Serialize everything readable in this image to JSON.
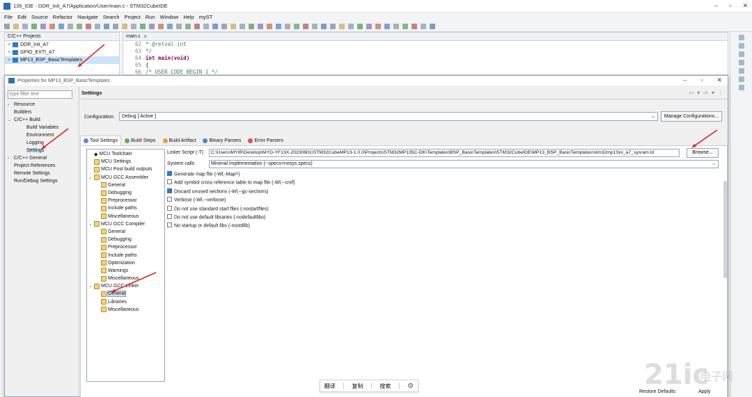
{
  "window": {
    "title": "135_IDE - DDR_Init_A7/Application/User/main.c - STM32CubeIDE"
  },
  "menu": [
    "File",
    "Edit",
    "Source",
    "Refactor",
    "Navigate",
    "Search",
    "Project",
    "Run",
    "Window",
    "Help",
    "myST"
  ],
  "project_view": {
    "tab_label": "C/C++ Projects",
    "projects": [
      "DDR_Init_A7",
      "GPIO_EXTI_A7",
      "MP13_BSP_BasicTemplates"
    ]
  },
  "editor": {
    "tab_label": "main.c",
    "lines": [
      {
        "num": "62",
        "text": " * @retval int"
      },
      {
        "num": "63",
        "text": " */"
      },
      {
        "num": "64",
        "text": "int main(void)"
      },
      {
        "num": "65",
        "text": "{"
      },
      {
        "num": "66",
        "text": "  /* USER CODE BEGIN 1 */"
      }
    ]
  },
  "dialog": {
    "title": "Properties for MP13_BSP_BasicTemplates",
    "filter_placeholder": "type filter text",
    "nav": [
      {
        "label": "Resource",
        "arrow": ">",
        "indent": 0
      },
      {
        "label": "Builders",
        "arrow": "",
        "indent": 0
      },
      {
        "label": "C/C++ Build",
        "arrow": "v",
        "indent": 0
      },
      {
        "label": "Build Variables",
        "arrow": "",
        "indent": 1
      },
      {
        "label": "Environment",
        "arrow": "",
        "indent": 1
      },
      {
        "label": "Logging",
        "arrow": "",
        "indent": 1
      },
      {
        "label": "Settings",
        "arrow": "",
        "indent": 1,
        "selected": true
      },
      {
        "label": "C/C++ General",
        "arrow": ">",
        "indent": 0
      },
      {
        "label": "Project References",
        "arrow": "",
        "indent": 0
      },
      {
        "label": "Remote Settings",
        "arrow": "",
        "indent": 0
      },
      {
        "label": "Run/Debug Settings",
        "arrow": "",
        "indent": 0
      }
    ],
    "header": "Settings",
    "configuration_label": "Configuration:",
    "configuration_value": "Debug  [ Active ]",
    "manage_button": "Manage Configurations...",
    "tabs": [
      {
        "label": "Tool Settings",
        "color": "#5b8ed6",
        "active": true
      },
      {
        "label": "Build Steps",
        "color": "#6aa84f"
      },
      {
        "label": "Build Artifact",
        "color": "#e6a23c"
      },
      {
        "label": "Binary Parsers",
        "color": "#4a86c8"
      },
      {
        "label": "Error Parsers",
        "color": "#d9534f"
      }
    ],
    "tool_tree": [
      {
        "label": "MCU Toolchain",
        "indent": 1,
        "tw": "",
        "icon": "diamond"
      },
      {
        "label": "MCU Settings",
        "indent": 1,
        "tw": ""
      },
      {
        "label": "MCU Post build outputs",
        "indent": 1,
        "tw": ""
      },
      {
        "label": "MCU GCC Assembler",
        "indent": 0,
        "tw": "v"
      },
      {
        "label": "General",
        "indent": 2,
        "tw": ""
      },
      {
        "label": "Debugging",
        "indent": 2,
        "tw": ""
      },
      {
        "label": "Preprocessor",
        "indent": 2,
        "tw": ""
      },
      {
        "label": "Include paths",
        "indent": 2,
        "tw": ""
      },
      {
        "label": "Miscellaneous",
        "indent": 2,
        "tw": ""
      },
      {
        "label": "MCU GCC Compiler",
        "indent": 0,
        "tw": "v"
      },
      {
        "label": "General",
        "indent": 2,
        "tw": ""
      },
      {
        "label": "Debugging",
        "indent": 2,
        "tw": ""
      },
      {
        "label": "Preprocessor",
        "indent": 2,
        "tw": ""
      },
      {
        "label": "Include paths",
        "indent": 2,
        "tw": ""
      },
      {
        "label": "Optimization",
        "indent": 2,
        "tw": ""
      },
      {
        "label": "Warnings",
        "indent": 2,
        "tw": ""
      },
      {
        "label": "Miscellaneous",
        "indent": 2,
        "tw": ""
      },
      {
        "label": "MCU GCC Linker",
        "indent": 0,
        "tw": "v"
      },
      {
        "label": "General",
        "indent": 2,
        "tw": "",
        "selected": true
      },
      {
        "label": "Libraries",
        "indent": 2,
        "tw": ""
      },
      {
        "label": "Miscellaneous",
        "indent": 2,
        "tw": ""
      }
    ],
    "linker_script_label": "Linker Script (-T)",
    "linker_script_value": "C:\\Users\\MYIR\\Desktop\\MYD-YF13X-20230601\\STM32CubeMP13-1.0.0\\Projects\\STM32MP135C-DK\\Templates\\BSP_BasicTemplates\\STM32CubeIDE\\MP13_BSP_BasicTemplates\\stm32mp13xx_a7_sysram.ld",
    "browse_button": "Browse...",
    "system_calls_label": "System calls",
    "system_calls_value": "Minimal implementation (--specs=nosys.specs)",
    "options": [
      {
        "label": "Generate map file (-Wl,-Map=)",
        "checked": true
      },
      {
        "label": "Add symbol cross reference table to map file (-Wl,--cref)",
        "checked": false
      },
      {
        "label": "Discard unused sections (-Wl,--gc-sections)",
        "checked": true
      },
      {
        "label": "Verbose (-Wl,--verbose)",
        "checked": false
      },
      {
        "label": "Do not use standard start files (-nostartfiles)",
        "checked": false
      },
      {
        "label": "Do not use default libraries (-nodefaultlibs)",
        "checked": false
      },
      {
        "label": "No startup or default libs (-nostdlib)",
        "checked": false
      }
    ],
    "float_toolbar": [
      "翻译",
      "复制",
      "搜索"
    ],
    "restore_defaults": "Restore Defaults",
    "apply": "Apply"
  },
  "watermark": {
    "main": "21ic",
    "sub": "电子网"
  },
  "colors": {
    "arrow": "#e02020",
    "selection": "#cde3f8",
    "checkbox_on": "#2f77d1"
  }
}
